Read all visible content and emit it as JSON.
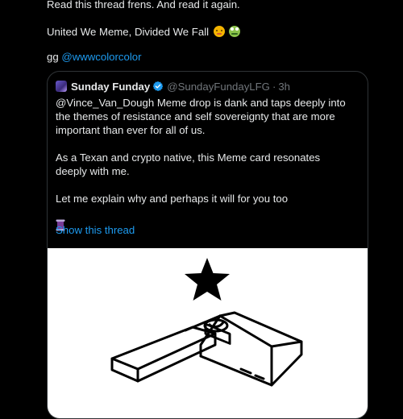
{
  "post": {
    "line1": "Read this thread frens. And read it again.",
    "line2": "United We Meme, Divided We Fall",
    "line3_prefix": "gg ",
    "mention": "@wwwcolorcolor",
    "emojis": [
      "pleading-face-emoji",
      "frog-emoji"
    ]
  },
  "quote": {
    "display_name": "Sunday Funday",
    "handle": "@SundayFundayLFG",
    "separator": "·",
    "time": "3h",
    "paragraphs": [
      "@Vince_Van_Dough Meme drop is dank and taps deeply into the themes of resistance and self sovereignty that are more important than ever for all of us.",
      "As a Texan and crypto native, this Meme card resonates deeply with me.",
      "Let me explain why and perhaps it will for you too"
    ],
    "show_thread": "Show this thread",
    "icons": [
      "verified-badge-icon",
      "thread-spool-icon"
    ]
  },
  "colors": {
    "background": "#000000",
    "text": "#e7e9ea",
    "muted": "#71767b",
    "link": "#1d9bf0",
    "border": "#2f3336"
  }
}
